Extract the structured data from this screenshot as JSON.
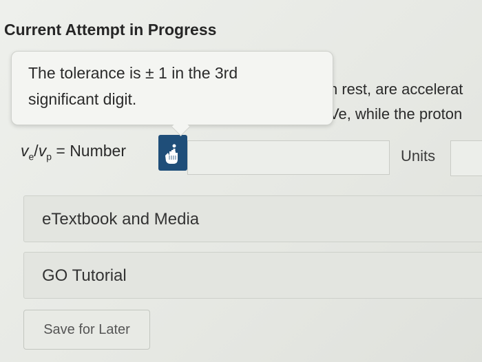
{
  "header": {
    "section_title": "Current Attempt in Progress"
  },
  "tooltip": {
    "text_line1": "The tolerance is ± 1 in the 3rd",
    "text_line2": "significant digit."
  },
  "question": {
    "line1": "n rest, are accelerat",
    "line2": "Ve, while the proton"
  },
  "answer": {
    "ratio_ve": "v",
    "ratio_ve_sub": "e",
    "ratio_slash": "/",
    "ratio_vp": "v",
    "ratio_vp_sub": "p",
    "equals_label": " = Number",
    "number_value": "",
    "units_label": "Units",
    "hint_icon": "hand-info-icon"
  },
  "resources": {
    "etextbook_label": "eTextbook and Media",
    "go_tutorial_label": "GO Tutorial"
  },
  "actions": {
    "save_label": "Save for Later"
  },
  "colors": {
    "hint_icon_bg": "#1f4e79",
    "background": "#e6e8e3"
  }
}
